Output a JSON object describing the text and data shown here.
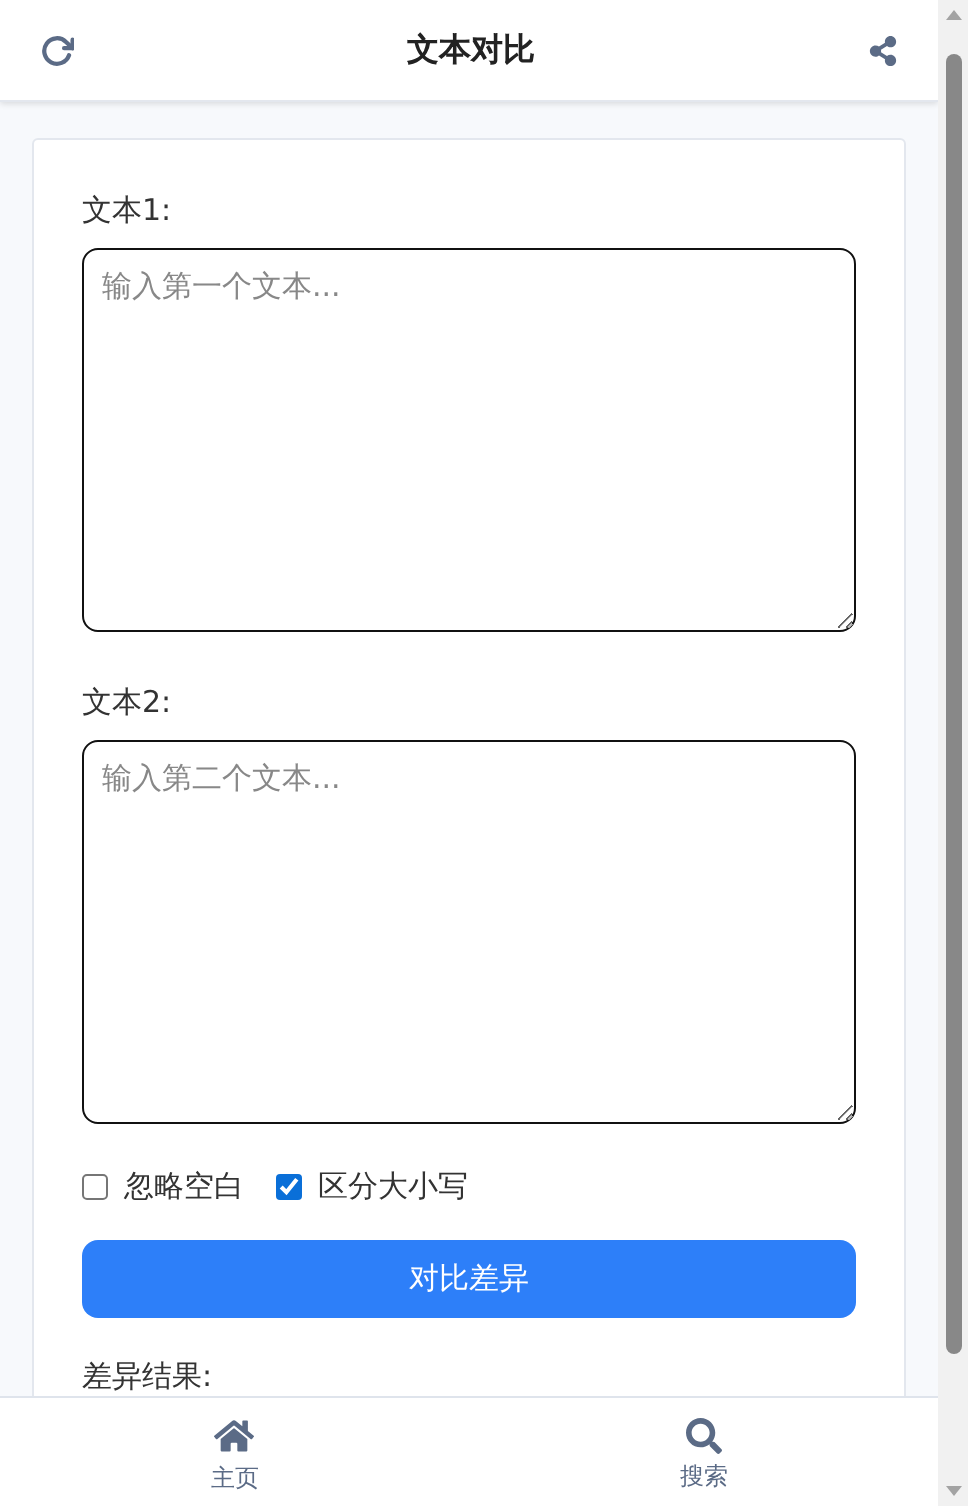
{
  "header": {
    "title": "文本对比"
  },
  "fields": [
    {
      "label": "文本1:",
      "placeholder": "输入第一个文本..."
    },
    {
      "label": "文本2:",
      "placeholder": "输入第二个文本..."
    }
  ],
  "options": [
    {
      "label": "忽略空白",
      "checked": false
    },
    {
      "label": "区分大小写",
      "checked": true
    }
  ],
  "compare_button": "对比差异",
  "result_label": "差异结果:",
  "bottom_nav": [
    {
      "label": "主页",
      "kind": "home"
    },
    {
      "label": "搜索",
      "kind": "search"
    }
  ]
}
